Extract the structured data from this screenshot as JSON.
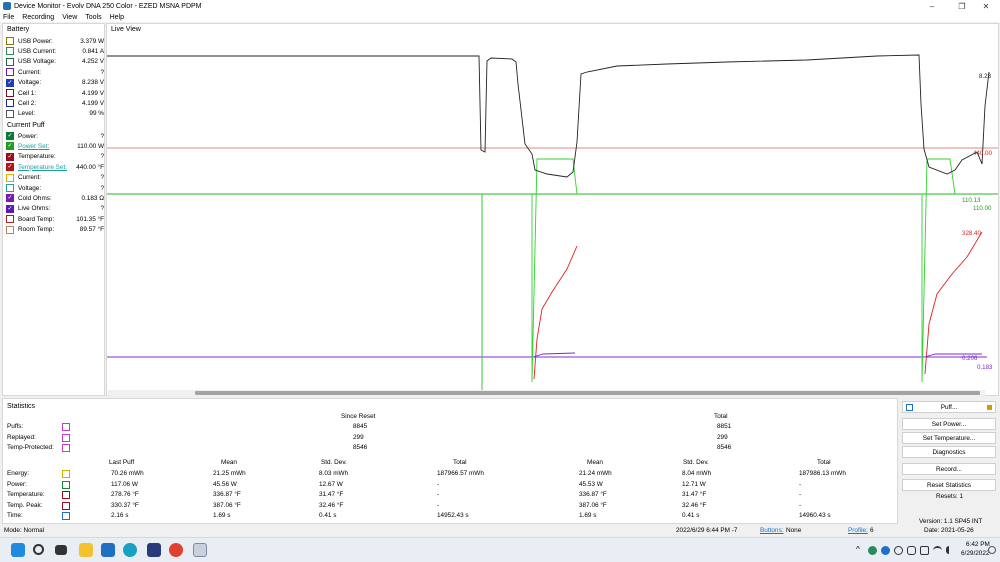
{
  "window": {
    "title": "Device Monitor - Evolv DNA 250 Color - EZED MSNA PDPM",
    "minimize": "–",
    "maximize": "❐",
    "close": "✕"
  },
  "menu": [
    "File",
    "Recording",
    "View",
    "Tools",
    "Help"
  ],
  "battery": {
    "heading": "Battery",
    "rows": [
      {
        "label": "USB Power:",
        "value": "3.379 W",
        "color": "#8b7a00",
        "checked": false
      },
      {
        "label": "USB Current:",
        "value": "0.841 A",
        "color": "#2e8b57",
        "checked": false
      },
      {
        "label": "USB Voltage:",
        "value": "4.252 V",
        "color": "#1e6b3a",
        "checked": false
      },
      {
        "label": "Current:",
        "value": "?",
        "color": "#6a1bb0",
        "checked": false
      },
      {
        "label": "Voltage:",
        "value": "8.238 V",
        "color": "#1f3fb0",
        "checked": true
      },
      {
        "label": "Cell 1:",
        "value": "4.199 V",
        "color": "#7a1020",
        "checked": false
      },
      {
        "label": "Cell 2:",
        "value": "4.199 V",
        "color": "#1a2a9a",
        "checked": false
      },
      {
        "label": "Level:",
        "value": "99 %",
        "color": "#555555",
        "checked": false
      }
    ]
  },
  "puff": {
    "heading": "Current Puff",
    "rows": [
      {
        "label": "Power:",
        "value": "?",
        "color": "#0a7a3a",
        "checked": true,
        "link": false
      },
      {
        "label": "Power Set:",
        "value": "110.00 W",
        "color": "#1ca01c",
        "checked": true,
        "link": true
      },
      {
        "label": "Temperature:",
        "value": "?",
        "color": "#9a1020",
        "checked": true,
        "link": false
      },
      {
        "label": "Temperature Set:",
        "value": "440.00 °F",
        "color": "#b01818",
        "checked": true,
        "link": true
      },
      {
        "label": "Current:",
        "value": "?",
        "color": "#d4b000",
        "checked": false,
        "link": false
      },
      {
        "label": "Voltage:",
        "value": "?",
        "color": "#2aa0a0",
        "checked": false,
        "link": false
      },
      {
        "label": "Cold Ohms:",
        "value": "0.183 Ω",
        "color": "#7a1ab0",
        "checked": true,
        "link": false
      },
      {
        "label": "Live Ohms:",
        "value": "?",
        "color": "#5a1ab0",
        "checked": true,
        "link": false
      },
      {
        "label": "Board Temp:",
        "value": "101.35 °F",
        "color": "#9a2a2a",
        "checked": false,
        "link": false
      },
      {
        "label": "Room Temp:",
        "value": "89.57 °F",
        "color": "#c08060",
        "checked": false,
        "link": false
      }
    ]
  },
  "liveview": {
    "title": "Live View",
    "labels": {
      "voltage": "8.23",
      "tempset": "440.00",
      "power1": "110.13",
      "power2": "110.00",
      "temp": "328.40",
      "ohms1": "0.206",
      "ohms2": "0.183"
    }
  },
  "stats": {
    "heading": "Statistics",
    "since_reset": "Since Reset",
    "total": "Total",
    "counts": [
      {
        "label": "Puffs:",
        "since": "8845",
        "total": "8851"
      },
      {
        "label": "Replayed:",
        "since": "299",
        "total": "299"
      },
      {
        "label": "Temp-Protected:",
        "since": "8546",
        "total": "8546"
      }
    ],
    "cols": {
      "last": "Last Puff",
      "mean": "Mean",
      "std": "Std. Dev.",
      "total": "Total"
    },
    "rows": [
      {
        "label": "Energy:",
        "color": "#d4b000",
        "last": "70.26 mWh",
        "mean": "21.25 mWh",
        "std": "8.03 mWh",
        "total": "187966.57 mWh",
        "mean2": "21.24 mWh",
        "std2": "8.04 mWh",
        "total2": "187986.13 mWh"
      },
      {
        "label": "Power:",
        "color": "#1a8a3a",
        "last": "117.06 W",
        "mean": "45.56 W",
        "std": "12.67 W",
        "total": "-",
        "mean2": "45.53 W",
        "std2": "12.71 W",
        "total2": "-"
      },
      {
        "label": "Temperature:",
        "color": "#9a1020",
        "last": "278.76 °F",
        "mean": "336.87 °F",
        "std": "31.47 °F",
        "total": "-",
        "mean2": "336.87 °F",
        "std2": "31.47 °F",
        "total2": "-"
      },
      {
        "label": "Temp. Peak:",
        "color": "#9a1020",
        "last": "330.37 °F",
        "mean": "387.06 °F",
        "std": "32.46 °F",
        "total": "-",
        "mean2": "387.06 °F",
        "std2": "32.46 °F",
        "total2": "-"
      },
      {
        "label": "Time:",
        "color": "#1f70c0",
        "last": "2.16 s",
        "mean": "1.69 s",
        "std": "0.41 s",
        "total": "14952.43 s",
        "mean2": "1.69 s",
        "std2": "0.41 s",
        "total2": "14960.43 s"
      }
    ]
  },
  "right": {
    "puff": "Puff...",
    "set_power": "Set Power...",
    "set_temp": "Set Temperature...",
    "diagnostics": "Diagnostics",
    "record": "Record...",
    "reset_stats": "Reset Statistics",
    "resets": "Resets: 1",
    "version": "Version: 1.1 SP45 INT",
    "date": "Date: 2021-05-26"
  },
  "status": {
    "mode": "Mode: Normal",
    "datetime": "2022/6/29 6:44 PM -7",
    "buttons_label": "Buttons:",
    "buttons_value": "None",
    "profile_label": "Profile:",
    "profile_value": "6"
  },
  "taskbar": {
    "time": "6:42 PM",
    "date": "6/29/2022"
  }
}
